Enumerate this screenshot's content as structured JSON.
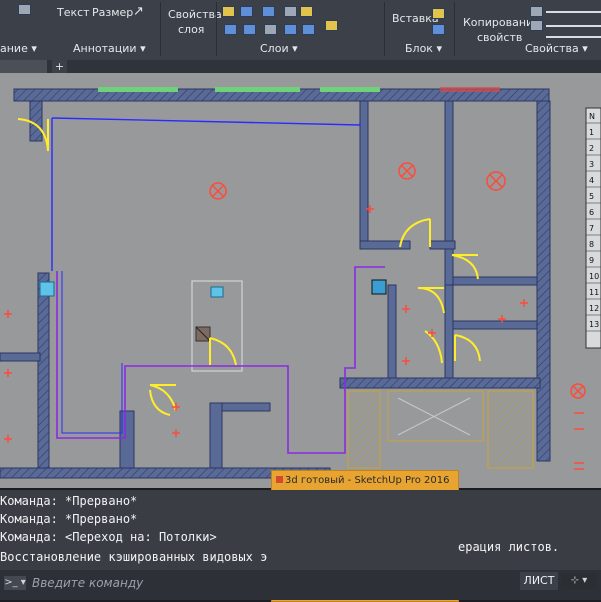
{
  "ribbon": {
    "text_label": "Текст",
    "dimension_label": "Размер",
    "layer_props_line1": "Свойства",
    "layer_props_line2": "слоя",
    "insert_label": "Вставка",
    "copy_props_line1": "Копирование",
    "copy_props_line2": "свойств",
    "groups": {
      "partial": "ание ▾",
      "annotations": "Аннотации ▾",
      "layers": "Слои ▾",
      "block": "Блок ▾",
      "properties": "Свойства ▾"
    }
  },
  "drawing": {
    "add_tab": "+",
    "right_table_rows": [
      "N",
      "1",
      "2",
      "3",
      "4",
      "5",
      "6",
      "7",
      "8",
      "9",
      "10",
      "11",
      "12",
      "13"
    ]
  },
  "popup": {
    "title": "3d готовый - SketchUp Pro 2016"
  },
  "console": {
    "lines": [
      "Команда: *Прервано*",
      "Команда: *Прервано*",
      "Команда:   <Переход на: Потолки>",
      "Восстановление кэшированных видовых э"
    ],
    "tail_text": "ерация листов."
  },
  "command": {
    "placeholder": "Введите команду",
    "button_label": ">_ ▾"
  },
  "status": {
    "layout_tab": "ЛИСТ",
    "icon_label": "⊹ ▾"
  },
  "colors": {
    "canvas": "#98999b",
    "wall": "#4b5a86",
    "ceiling_line": "#2a2cff",
    "purple_line": "#8a2be2",
    "door": "#ffec2a",
    "fixture": "#ff4a3a"
  }
}
